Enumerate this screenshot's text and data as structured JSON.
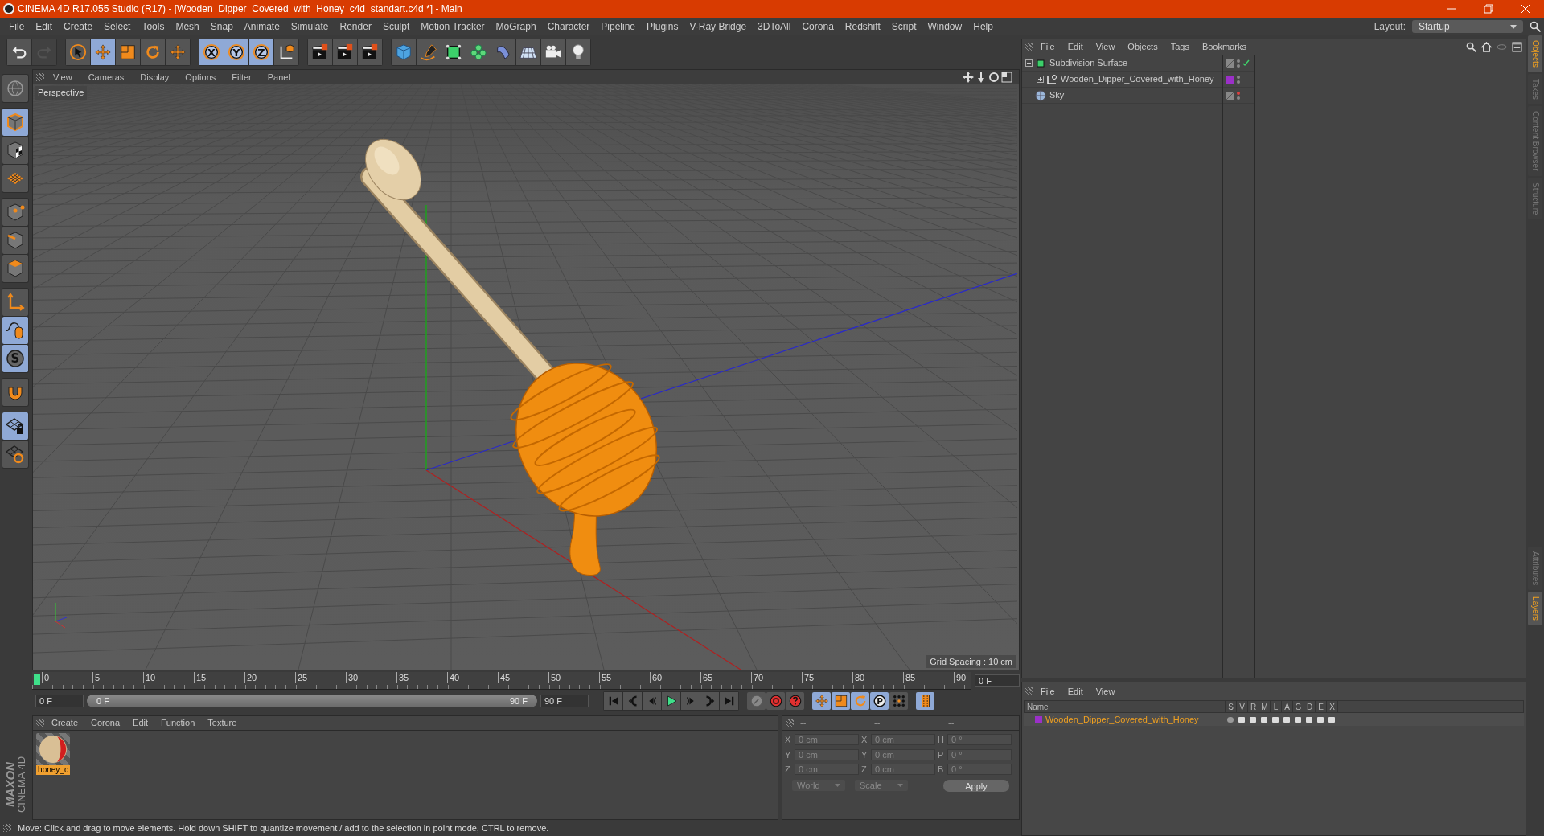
{
  "window": {
    "title": "CINEMA 4D R17.055 Studio (R17) - [Wooden_Dipper_Covered_with_Honey_c4d_standart.c4d *] - Main"
  },
  "menu_bar": [
    "File",
    "Edit",
    "Create",
    "Select",
    "Tools",
    "Mesh",
    "Snap",
    "Animate",
    "Simulate",
    "Render",
    "Sculpt",
    "Motion Tracker",
    "MoGraph",
    "Character",
    "Pipeline",
    "Plugins",
    "V-Ray Bridge",
    "3DToAll",
    "Corona",
    "Redshift",
    "Script",
    "Window",
    "Help"
  ],
  "layout": {
    "label": "Layout:",
    "value": "Startup"
  },
  "top_toolbar": [
    [
      {
        "kind": "undo",
        "selected": false,
        "disabled": false
      },
      {
        "kind": "redo",
        "selected": false,
        "disabled": true
      }
    ],
    [
      {
        "kind": "select",
        "selected": false,
        "disabled": false
      },
      {
        "kind": "move",
        "selected": true,
        "disabled": false
      },
      {
        "kind": "scale",
        "selected": false,
        "disabled": false
      },
      {
        "kind": "rotate",
        "selected": false,
        "disabled": false
      },
      {
        "kind": "move",
        "selected": false,
        "disabled": false
      }
    ],
    [
      {
        "kind": "axis",
        "label": "X",
        "selected": true,
        "disabled": false
      },
      {
        "kind": "axis",
        "label": "Y",
        "selected": true,
        "disabled": false
      },
      {
        "kind": "axis",
        "label": "Z",
        "selected": true,
        "disabled": false
      },
      {
        "kind": "coord",
        "selected": false,
        "disabled": false
      }
    ],
    [
      {
        "kind": "render",
        "selected": false,
        "disabled": false
      },
      {
        "kind": "render",
        "selected": false,
        "disabled": false
      },
      {
        "kind": "render",
        "selected": false,
        "disabled": false
      }
    ],
    [
      {
        "kind": "cube",
        "selected": false,
        "disabled": false
      },
      {
        "kind": "pen",
        "selected": false,
        "disabled": false
      },
      {
        "kind": "subdivision",
        "selected": false,
        "disabled": false
      },
      {
        "kind": "cloner",
        "selected": false,
        "disabled": false
      },
      {
        "kind": "deformer",
        "selected": false,
        "disabled": false
      },
      {
        "kind": "floor",
        "selected": false,
        "disabled": false
      },
      {
        "kind": "camera",
        "selected": false,
        "disabled": false
      },
      {
        "kind": "light",
        "selected": false,
        "disabled": false
      }
    ]
  ],
  "left_toolbar": [
    [
      {
        "kind": "globe",
        "selected": false
      }
    ],
    [
      {
        "kind": "model",
        "selected": true
      },
      {
        "kind": "texture",
        "selected": false
      },
      {
        "kind": "workplane",
        "selected": false
      }
    ],
    [
      {
        "kind": "points",
        "selected": false
      },
      {
        "kind": "edges",
        "selected": false
      },
      {
        "kind": "polygons",
        "selected": false
      }
    ],
    [
      {
        "kind": "axis",
        "selected": false
      },
      {
        "kind": "tweak",
        "selected": true
      },
      {
        "kind": "snap",
        "label": "S",
        "selected": true
      }
    ],
    [
      {
        "kind": "magnet",
        "selected": false
      }
    ],
    [
      {
        "kind": "lock",
        "selected": true
      },
      {
        "kind": "sync",
        "selected": false
      }
    ]
  ],
  "maxon_logo": {
    "brand": "MAXON",
    "product": "CINEMA 4D"
  },
  "viewport": {
    "menu": [
      "View",
      "Cameras",
      "Display",
      "Options",
      "Filter",
      "Panel"
    ],
    "camera": "Perspective",
    "grid_spacing": "Grid Spacing : 10 cm"
  },
  "timeline": {
    "ticks": [
      "0",
      "5",
      "10",
      "15",
      "20",
      "25",
      "30",
      "35",
      "40",
      "45",
      "50",
      "55",
      "60",
      "65",
      "70",
      "75",
      "80",
      "85",
      "90"
    ],
    "current_frame": "0 F",
    "start_field": "0 F",
    "range_start": "0 F",
    "range_end": "90 F",
    "range_slider": {
      "level": 1
    },
    "end_field": "90 F",
    "transport": [
      {
        "kind": "go-start"
      },
      {
        "kind": "prev-key"
      },
      {
        "kind": "prev-frame"
      },
      {
        "kind": "play"
      },
      {
        "kind": "next-frame"
      },
      {
        "kind": "next-key"
      },
      {
        "kind": "go-end"
      }
    ],
    "key_tools": [
      {
        "kind": "keyframe",
        "selected": false
      },
      {
        "kind": "autokey",
        "selected": false
      },
      {
        "kind": "help",
        "selected": false
      },
      {
        "kind": "move",
        "selected": true
      },
      {
        "kind": "scale",
        "selected": true
      },
      {
        "kind": "rotate",
        "selected": true
      },
      {
        "kind": "param",
        "label": "P",
        "selected": true
      },
      {
        "kind": "points-grid",
        "selected": false
      },
      {
        "kind": "film",
        "selected": true
      }
    ]
  },
  "material_manager": {
    "menu": [
      "Create",
      "Corona",
      "Edit",
      "Function",
      "Texture"
    ],
    "materials": [
      {
        "name": "honey_c",
        "selected": true
      }
    ]
  },
  "coordinates": {
    "headers": [
      "--",
      "--",
      "--"
    ],
    "rows": [
      {
        "label_1": "X",
        "value_1": "0 cm",
        "label_2": "X",
        "value_2": "0 cm",
        "label_3": "H",
        "value_3": "0 °"
      },
      {
        "label_1": "Y",
        "value_1": "0 cm",
        "label_2": "Y",
        "value_2": "0 cm",
        "label_3": "P",
        "value_3": "0 °"
      },
      {
        "label_1": "Z",
        "value_1": "0 cm",
        "label_2": "Z",
        "value_2": "0 cm",
        "label_3": "B",
        "value_3": "0 °"
      }
    ],
    "dropdowns": [
      "World",
      "Scale"
    ],
    "apply": "Apply"
  },
  "status_bar": "Move: Click and drag to move elements. Hold down SHIFT to quantize movement / add to the selection in point mode, CTRL to remove.",
  "object_manager": {
    "menu": [
      "File",
      "Edit",
      "View",
      "Objects",
      "Tags",
      "Bookmarks"
    ],
    "objects": [
      {
        "name": "Subdivision Surface",
        "kind": "subdivision",
        "expanded": true,
        "editor_hidden": false,
        "enabled": true,
        "children": [
          {
            "name": "Wooden_Dipper_Covered_with_Honey",
            "kind": "null",
            "expanded": false,
            "editor_hidden": false,
            "color": "#9b30c8"
          }
        ]
      },
      {
        "name": "Sky",
        "kind": "sky",
        "editor_hidden": true
      }
    ]
  },
  "side_tabs": [
    {
      "label": "Objects",
      "selected": true
    },
    {
      "label": "Takes",
      "selected": false
    },
    {
      "label": "Content Browser",
      "selected": false
    },
    {
      "label": "Structure",
      "selected": false
    }
  ],
  "layer_manager": {
    "menu": [
      "File",
      "Edit",
      "View"
    ],
    "columns": [
      "Name",
      "S",
      "V",
      "R",
      "M",
      "L",
      "A",
      "G",
      "D",
      "E",
      "X"
    ],
    "layers": [
      {
        "name": "Wooden_Dipper_Covered_with_Honey",
        "color": "#9b30c8"
      }
    ]
  },
  "bottom_side_tabs": [
    {
      "label": "Attributes",
      "selected": false
    },
    {
      "label": "Layers",
      "selected": true
    }
  ]
}
